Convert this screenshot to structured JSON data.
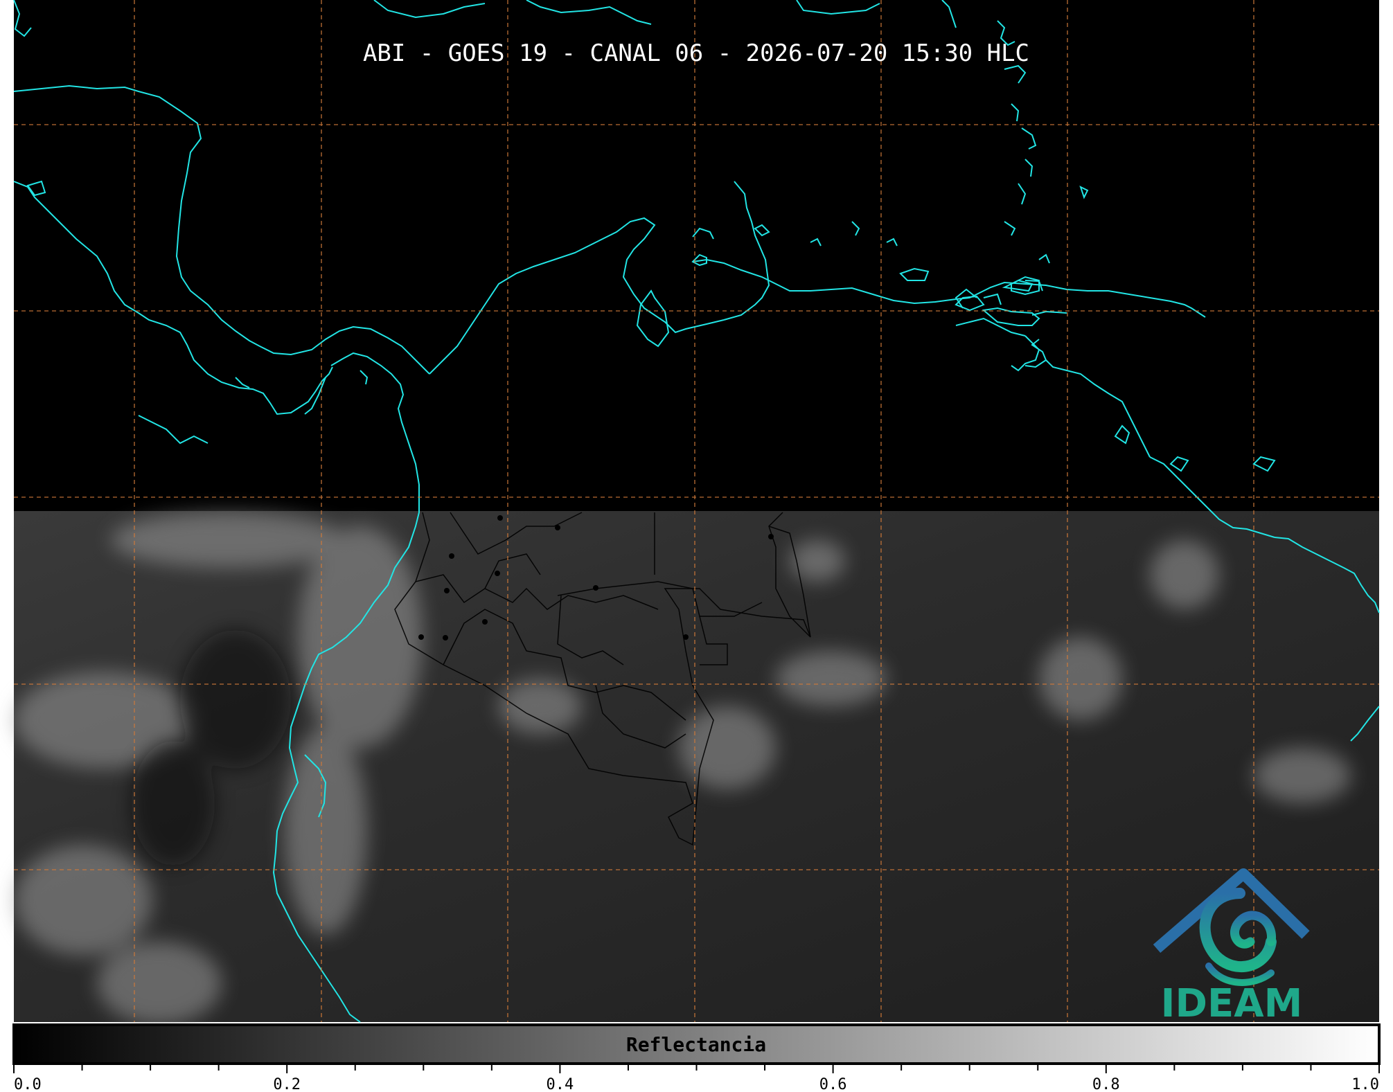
{
  "title": "ABI - GOES 19 - CANAL 06 - 2026-07-20 15:30 HLC",
  "colorbar": {
    "label": "Reflectancia",
    "tick_labels": [
      "0.0",
      "0.2",
      "0.4",
      "0.6",
      "0.8",
      "1.0"
    ],
    "min": 0.0,
    "max": 1.0,
    "gradient_start": "#000000",
    "gradient_end": "#ffffff"
  },
  "logo": {
    "text": "IDEAM",
    "color": "#1fa88a",
    "roof_color": "#2a6fa8"
  },
  "colors": {
    "background": "#000000",
    "coastline": "#22e5e5",
    "gridline": "#d07a3a",
    "borders": "#000000"
  },
  "icons": [
    "ideam-logo-icon"
  ]
}
